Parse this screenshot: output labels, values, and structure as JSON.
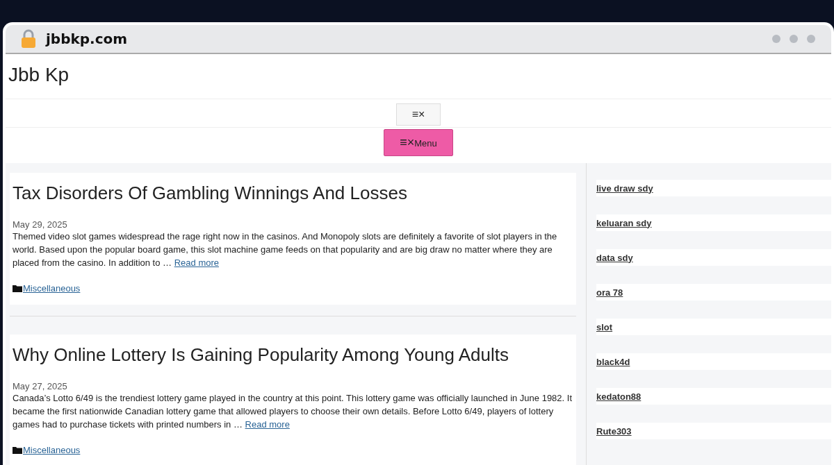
{
  "browser": {
    "address": "jbbkp.com"
  },
  "site": {
    "title": "Jbb Kp"
  },
  "nav": {
    "toggle_icon": "≡×",
    "menu_button": {
      "icon": "≡×",
      "label": "Menu"
    }
  },
  "posts": [
    {
      "title": "Tax Disorders Of Gambling Winnings And Losses",
      "date": "May 29, 2025",
      "excerpt": "Themed video slot games widespread the rage right now in the casinos. And Monopoly slots are definitely a favorite of slot players in the world. Based upon the popular board game, this slot machine game feeds on that popularity and are big draw no matter where they are placed from the casino. In addition to …",
      "read_more": "Read more",
      "category": "Miscellaneous"
    },
    {
      "title": "Why Online Lottery Is Gaining Popularity Among Young Adults",
      "date": "May 27, 2025",
      "excerpt": "Canada’s Lotto 6/49 is the trendiest lottery game played in the country at this point. This lottery game was officially launched in June 1982. It became the first nationwide Canadian lottery game that allowed players to choose their own details. Before Lotto 6/49, players of lottery games had to purchase tickets with printed numbers in …",
      "read_more": "Read more",
      "category": "Miscellaneous"
    }
  ],
  "sidebar": {
    "links": [
      "live draw sdy",
      "keluaran sdy",
      "data sdy",
      "ora 78",
      "slot",
      "black4d",
      "kedaton88",
      "Rute303"
    ]
  }
}
